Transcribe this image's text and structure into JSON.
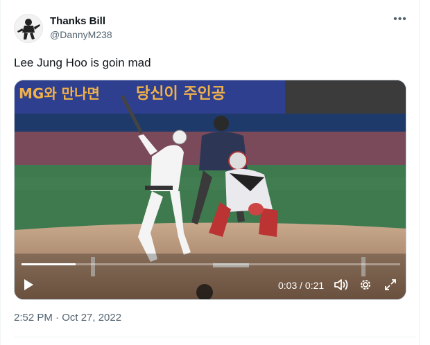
{
  "tweet": {
    "display_name": "Thanks Bill",
    "handle": "@DannyM238",
    "text": "Lee Jung Hoo is goin mad",
    "timestamp": "2:52 PM · Oct 27, 2022",
    "more_icon": "more-horizontal-icon"
  },
  "video": {
    "elapsed": "0:03",
    "duration": "0:21",
    "time_display": "0:03 / 0:21",
    "progress_fraction": 0.143,
    "banner_left": "MG와 만나면",
    "banner_right": "당신이 주인공",
    "controls": {
      "play_icon": "play-icon",
      "volume_icon": "volume-icon",
      "settings_icon": "settings-gear-icon",
      "fullscreen_icon": "fullscreen-icon"
    }
  },
  "colors": {
    "text_primary": "#0f1419",
    "text_secondary": "#536471",
    "border": "#cfd9de"
  }
}
